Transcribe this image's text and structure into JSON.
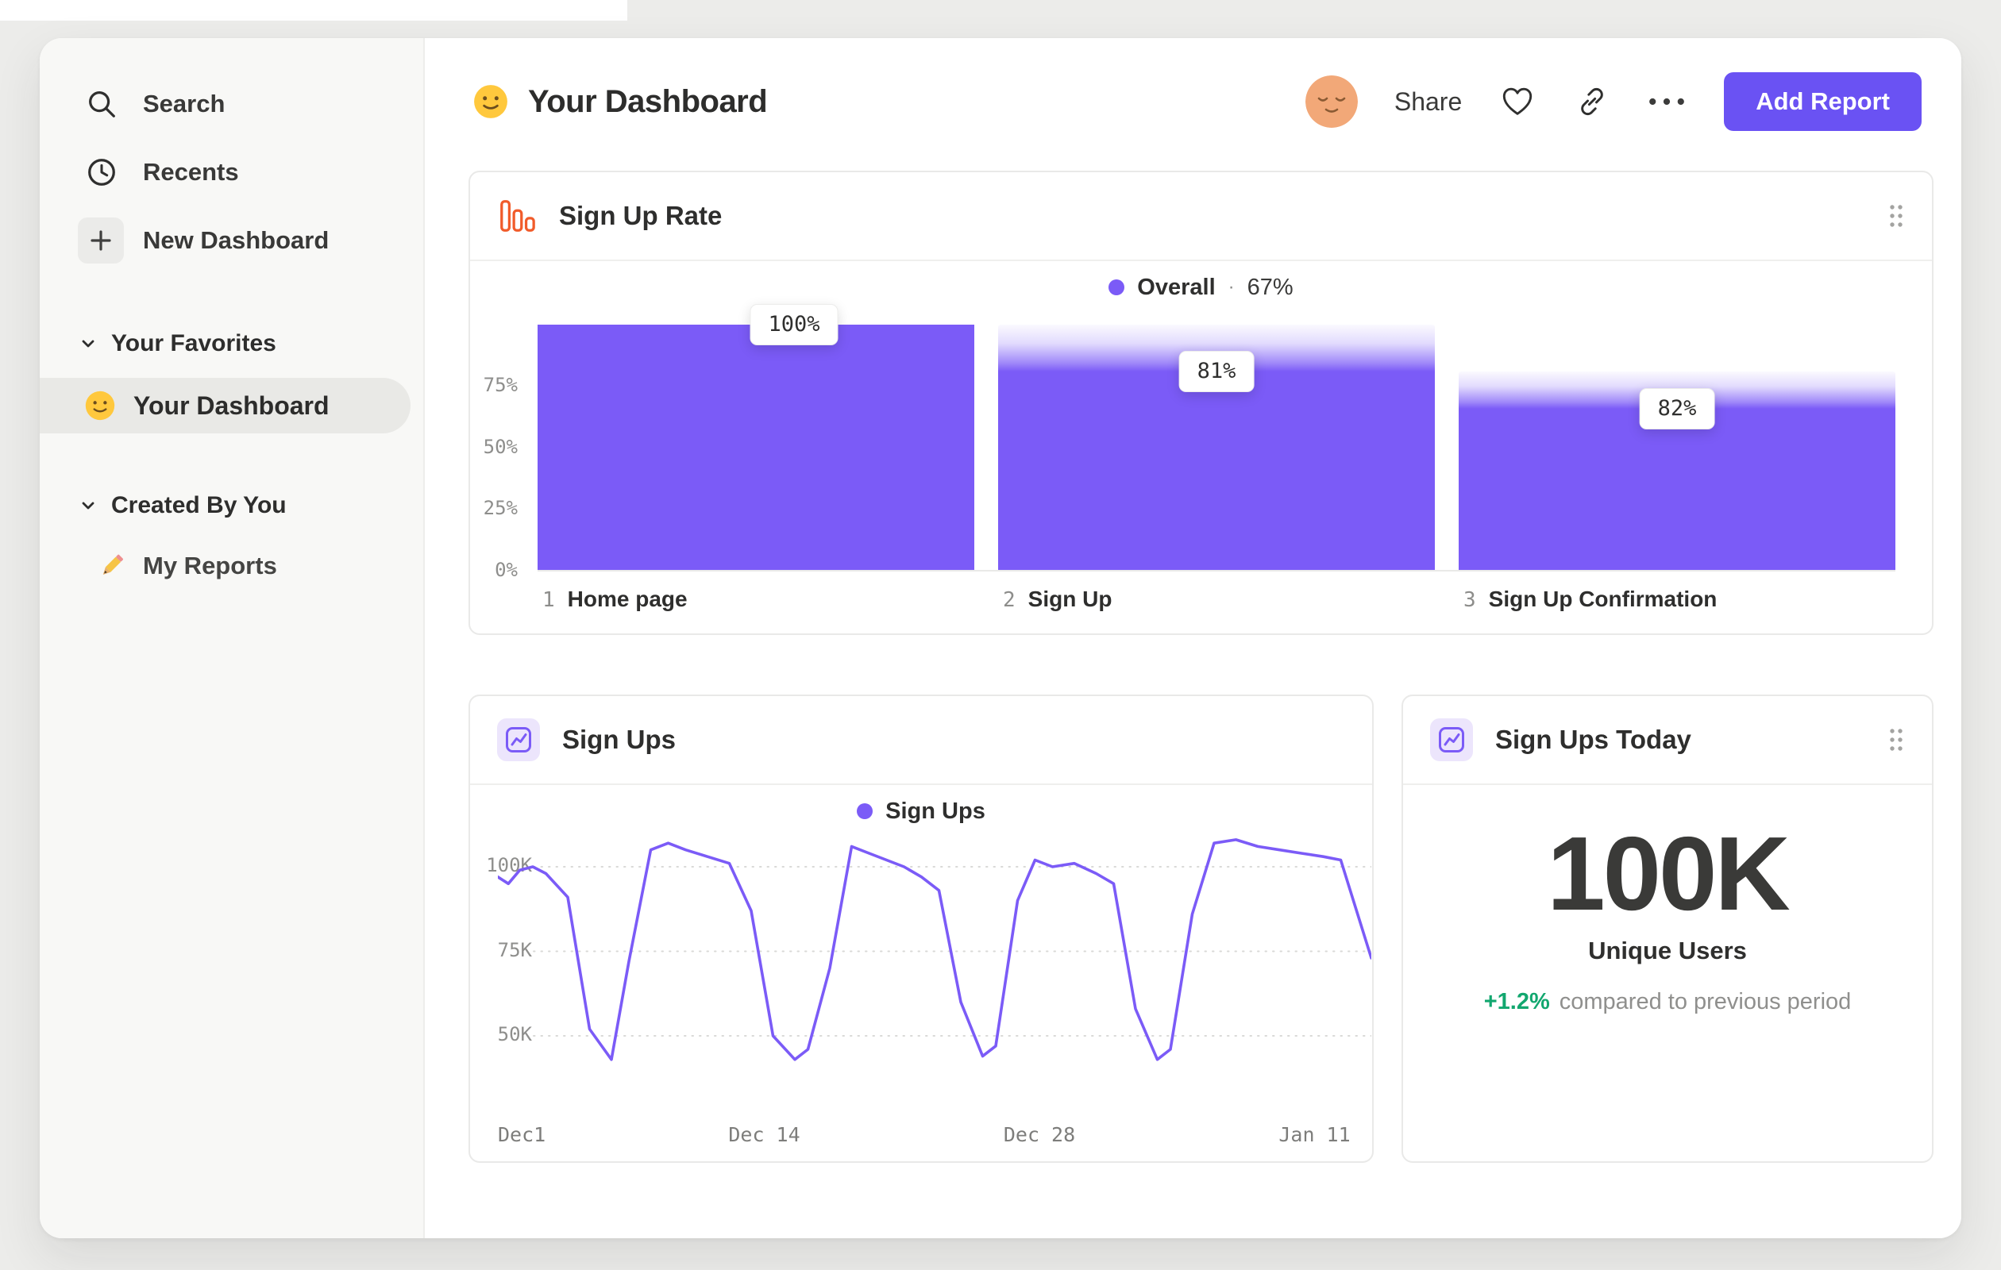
{
  "header": {
    "title": "Your Dashboard",
    "share": "Share",
    "add_report": "Add Report"
  },
  "sidebar": {
    "search": "Search",
    "recents": "Recents",
    "new_dashboard": "New Dashboard",
    "favorites_header": "Your Favorites",
    "favorite_dashboard": "Your Dashboard",
    "created_header": "Created By You",
    "my_reports": "My Reports"
  },
  "cards": {
    "funnel": {
      "title": "Sign Up Rate",
      "legend_label": "Overall",
      "legend_sep": "·",
      "legend_value": "67%"
    },
    "line": {
      "title": "Sign Ups",
      "legend_label": "Sign Ups"
    },
    "metric": {
      "title": "Sign Ups Today",
      "value": "100K",
      "label": "Unique Users",
      "delta": "+1.2%",
      "delta_suffix": "compared to previous period"
    }
  },
  "chart_data": [
    {
      "type": "funnel",
      "title": "Sign Up Rate",
      "legend": "Overall",
      "overall_conversion": "67%",
      "y_axis": [
        {
          "label": "75%",
          "value": 75
        },
        {
          "label": "50%",
          "value": 50
        },
        {
          "label": "25%",
          "value": 25
        },
        {
          "label": "0%",
          "value": 0
        }
      ],
      "steps": [
        {
          "index": "1",
          "label": "Home page",
          "shown_label": "100%",
          "pct_overall": 100,
          "pct_of_previous": 100
        },
        {
          "index": "2",
          "label": "Sign Up",
          "shown_label": "81%",
          "pct_overall": 81,
          "pct_of_previous": 81
        },
        {
          "index": "3",
          "label": "Sign Up Confirmation",
          "shown_label": "82%",
          "pct_overall": 66,
          "pct_of_previous": 82
        }
      ]
    },
    {
      "type": "line",
      "title": "Sign Ups",
      "series": [
        {
          "name": "Sign Ups",
          "unit": "K",
          "points": [
            [
              0,
              97
            ],
            [
              1.2,
              95
            ],
            [
              2.5,
              99
            ],
            [
              4,
              100
            ],
            [
              5.5,
              98
            ],
            [
              8,
              91
            ],
            [
              10.5,
              52
            ],
            [
              13,
              43
            ],
            [
              15,
              72
            ],
            [
              17.5,
              105
            ],
            [
              19.5,
              107
            ],
            [
              21.5,
              105
            ],
            [
              24,
              103
            ],
            [
              26.5,
              101
            ],
            [
              29,
              87
            ],
            [
              31.5,
              50
            ],
            [
              34,
              43
            ],
            [
              35.5,
              46
            ],
            [
              38,
              70
            ],
            [
              40.5,
              106
            ],
            [
              42.5,
              104
            ],
            [
              44.5,
              102
            ],
            [
              46.5,
              100
            ],
            [
              48.5,
              97
            ],
            [
              50.5,
              93
            ],
            [
              53,
              60
            ],
            [
              55.5,
              44
            ],
            [
              57,
              47
            ],
            [
              59.5,
              90
            ],
            [
              61.5,
              102
            ],
            [
              63.5,
              100
            ],
            [
              66,
              101
            ],
            [
              68.5,
              98
            ],
            [
              70.5,
              95
            ],
            [
              73,
              58
            ],
            [
              75.5,
              43
            ],
            [
              77,
              46
            ],
            [
              79.5,
              86
            ],
            [
              82,
              107
            ],
            [
              84.5,
              108
            ],
            [
              87,
              106
            ],
            [
              89.5,
              105
            ],
            [
              92,
              104
            ],
            [
              94.5,
              103
            ],
            [
              96.5,
              102
            ],
            [
              100,
              73
            ]
          ]
        }
      ],
      "y_ticks": [
        {
          "label": "100K",
          "value": 100
        },
        {
          "label": "75K",
          "value": 75
        },
        {
          "label": "50K",
          "value": 50
        }
      ],
      "x_ticks": [
        {
          "label": "Dec1",
          "pos": 0
        },
        {
          "label": "Dec 14",
          "pos": 30.5
        },
        {
          "label": "Dec 28",
          "pos": 62
        },
        {
          "label": "Jan 11",
          "pos": 93.5
        }
      ]
    },
    {
      "type": "metric",
      "title": "Sign Ups Today",
      "value": "100K",
      "label": "Unique Users",
      "delta": "+1.2%",
      "delta_text": "compared to previous period"
    }
  ],
  "colors": {
    "accent": "#7b5bf7",
    "button": "#6a52f3",
    "orange": "#f15b2a",
    "green": "#12a76f",
    "sidebar_bg": "#f8f8f6",
    "selected_pill": "#e9e9e6"
  }
}
